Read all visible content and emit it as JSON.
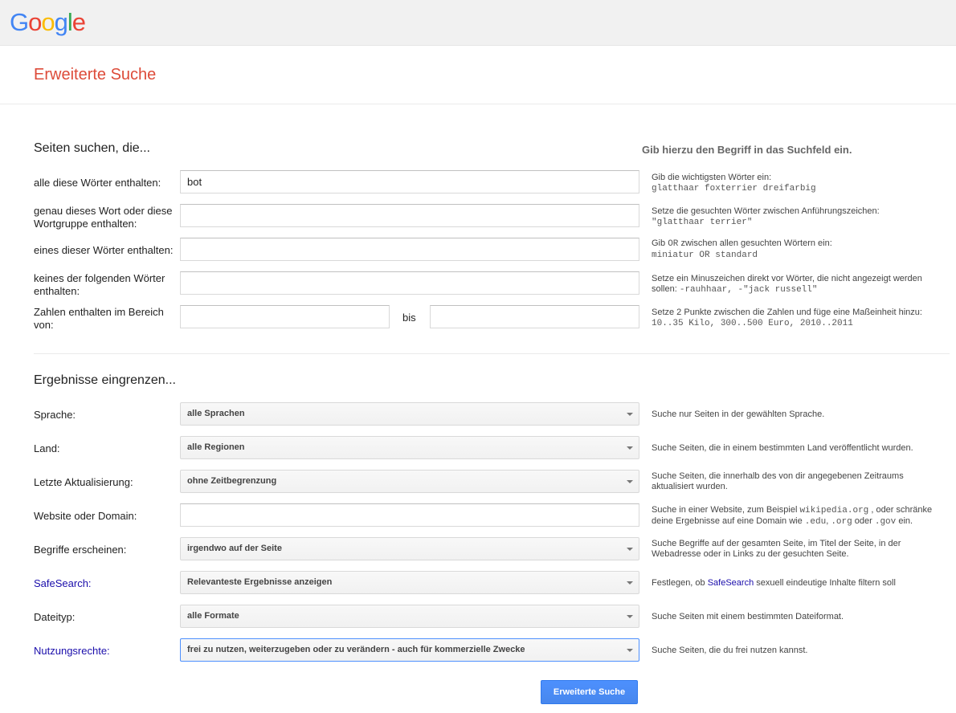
{
  "header": {
    "logo_letters": [
      "G",
      "o",
      "o",
      "g",
      "l",
      "e"
    ],
    "logo_colors": [
      "#4285f4",
      "#ea4335",
      "#fbbc05",
      "#4285f4",
      "#34a853",
      "#ea4335"
    ]
  },
  "page": {
    "title": "Erweiterte Suche"
  },
  "find": {
    "title": "Seiten suchen, die...",
    "hint_heading": "Gib hierzu den Begriff in das Suchfeld ein.",
    "all_words": {
      "label": "alle diese Wörter enthalten:",
      "value": "bot",
      "help": "Gib die wichtigsten Wörter ein:",
      "example": "glatthaar foxterrier dreifarbig"
    },
    "exact": {
      "label": "genau dieses Wort oder diese Wortgruppe enthalten:",
      "value": "",
      "help": "Setze die gesuchten Wörter zwischen Anführungszeichen:",
      "example": "\"glatthaar terrier\""
    },
    "any": {
      "label": "eines dieser Wörter enthalten:",
      "value": "",
      "help_pre": "Gib ",
      "help_or": "OR",
      "help_post": " zwischen allen gesuchten Wörtern ein:",
      "example": "miniatur OR standard"
    },
    "none": {
      "label": "keines der folgenden Wörter enthalten:",
      "value": "",
      "help": "Setze ein Minuszeichen direkt vor Wörter, die nicht angezeigt werden sollen:",
      "example": "-rauhhaar, -\"jack russell\""
    },
    "range": {
      "label": "Zahlen enthalten im Bereich von:",
      "from": "",
      "to_label": "bis",
      "to": "",
      "help": "Setze 2 Punkte zwischen die Zahlen und füge eine Maßeinheit hinzu:",
      "example": "10..35 Kilo, 300..500 Euro, 2010..2011"
    }
  },
  "narrow": {
    "title": "Ergebnisse eingrenzen...",
    "language": {
      "label": "Sprache:",
      "value": "alle Sprachen",
      "help": "Suche nur Seiten in der gewählten Sprache."
    },
    "region": {
      "label": "Land:",
      "value": "alle Regionen",
      "help": "Suche Seiten, die in einem bestimmten Land veröffentlicht wurden."
    },
    "updated": {
      "label": "Letzte Aktualisierung:",
      "value": "ohne Zeitbegrenzung",
      "help": "Suche Seiten, die innerhalb des von dir angegebenen Zeitraums aktualisiert wurden."
    },
    "site": {
      "label": "Website oder Domain:",
      "value": "",
      "help_1": "Suche in einer Website, zum Beispiel ",
      "ex_1": "wikipedia.org",
      "help_2": " , oder schränke deine Ergebnisse auf eine Domain wie ",
      "ex_2": ".edu",
      "help_3": ", ",
      "ex_3": ".org",
      "help_4": " oder ",
      "ex_4": ".gov",
      "help_5": " ein."
    },
    "occurrence": {
      "label": "Begriffe erscheinen:",
      "value": "irgendwo auf der Seite",
      "help": "Suche Begriffe auf der gesamten Seite, im Titel der Seite, in der Webadresse oder in Links zu der gesuchten Seite."
    },
    "safesearch": {
      "label": "SafeSearch:",
      "value": "Relevanteste Ergebnisse anzeigen",
      "help_1": "Festlegen, ob ",
      "help_link": "SafeSearch",
      "help_2": " sexuell eindeutige Inhalte filtern soll"
    },
    "filetype": {
      "label": "Dateityp:",
      "value": "alle Formate",
      "help": "Suche Seiten mit einem bestimmten Dateiformat."
    },
    "rights": {
      "label": "Nutzungsrechte:",
      "value": "frei zu nutzen, weiterzugeben oder zu verändern - auch für kommerzielle Zwecke",
      "help": "Suche Seiten, die du frei nutzen kannst."
    }
  },
  "submit_label": "Erweiterte Suche"
}
